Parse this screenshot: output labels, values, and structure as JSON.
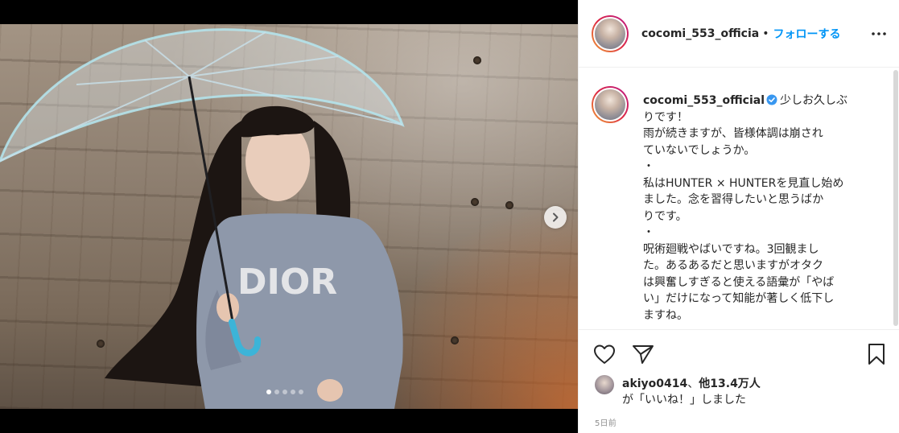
{
  "post": {
    "username": "cocomi_553_officia",
    "separator": "•",
    "follow_label": "フォローする",
    "more_icon": "more-horizontal-icon",
    "carousel": {
      "total_slides": 5,
      "active_slide": 1,
      "next_icon": "chevron-right-icon"
    }
  },
  "caption": {
    "username": "cocomi_553_official",
    "verified_icon": "verified-badge-icon",
    "lines": [
      "少しお久しぶ",
      "りです！",
      "雨が続きますが、皆様体調は崩され",
      "ていないでしょうか。",
      "・",
      "私はHUNTER × HUNTERを見直し始め",
      "ました。念を習得したいと思うばか",
      "りです。",
      "・",
      "呪術廻戦やばいですね。3回観まし",
      "た。あるあるだと思いますがオタク",
      "は興奮しすぎると使える語彙が「やば",
      "い」だけになって知能が著しく低下し",
      "ますね。"
    ]
  },
  "actions": {
    "like_icon": "heart-icon",
    "share_icon": "paper-plane-icon",
    "save_icon": "bookmark-icon"
  },
  "likes": {
    "user": "akiyo0414",
    "joiner": "、",
    "others": "他13.4万人",
    "suffix": "が「いいね！」しました"
  },
  "timestamp": "5日前",
  "colors": {
    "accent": "#0095f6",
    "text": "#262626",
    "muted": "#8e8e8e",
    "border": "#efefef"
  }
}
